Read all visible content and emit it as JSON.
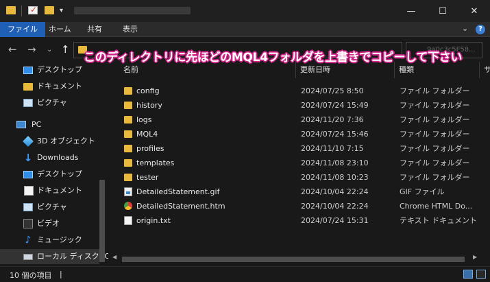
{
  "titlebar": {
    "dropdown_glyph": "▾",
    "minimize_glyph": "—",
    "maximize_glyph": "☐",
    "close_glyph": "✕"
  },
  "ribbon": {
    "tabs": [
      "ファイル",
      "ホーム",
      "共有",
      "表示"
    ],
    "expand_glyph": "⌄",
    "help_glyph": "?"
  },
  "address": {
    "back_glyph": "←",
    "forward_glyph": "→",
    "recent_glyph": "⌄",
    "up_glyph": "↑",
    "search_fragment": "9a0c3c5F58...",
    "annotation": "このディレクトリに先ほどのMQL4フォルダを上書きでコピーして下さい"
  },
  "nav": {
    "items": [
      {
        "label": "デスクトップ",
        "icon": "desktop-icon"
      },
      {
        "label": "ドキュメント",
        "icon": "folder-icon"
      },
      {
        "label": "ピクチャ",
        "icon": "pictures-icon"
      },
      {
        "label": "PC",
        "icon": "pc-icon"
      },
      {
        "label": "3D オブジェクト",
        "icon": "3d-objects-icon"
      },
      {
        "label": "Downloads",
        "icon": "download-icon"
      },
      {
        "label": "デスクトップ",
        "icon": "desktop-icon"
      },
      {
        "label": "ドキュメント",
        "icon": "document-icon"
      },
      {
        "label": "ピクチャ",
        "icon": "pictures-icon"
      },
      {
        "label": "ビデオ",
        "icon": "video-icon"
      },
      {
        "label": "ミュージック",
        "icon": "music-icon"
      },
      {
        "label": "ローカル ディスク (C",
        "icon": "drive-icon"
      }
    ]
  },
  "columns": {
    "name": "名前",
    "date": "更新日時",
    "type": "種類",
    "size": "サ"
  },
  "files": [
    {
      "name": "config",
      "date": "2024/07/25 8:50",
      "type": "ファイル フォルダー",
      "icon": "folder"
    },
    {
      "name": "history",
      "date": "2024/07/24 15:49",
      "type": "ファイル フォルダー",
      "icon": "folder"
    },
    {
      "name": "logs",
      "date": "2024/11/20 7:36",
      "type": "ファイル フォルダー",
      "icon": "folder"
    },
    {
      "name": "MQL4",
      "date": "2024/07/24 15:46",
      "type": "ファイル フォルダー",
      "icon": "folder"
    },
    {
      "name": "profiles",
      "date": "2024/11/10 7:15",
      "type": "ファイル フォルダー",
      "icon": "folder"
    },
    {
      "name": "templates",
      "date": "2024/11/08 23:10",
      "type": "ファイル フォルダー",
      "icon": "folder"
    },
    {
      "name": "tester",
      "date": "2024/11/08 10:23",
      "type": "ファイル フォルダー",
      "icon": "folder"
    },
    {
      "name": "DetailedStatement.gif",
      "date": "2024/10/04 22:24",
      "type": "GIF ファイル",
      "icon": "gif"
    },
    {
      "name": "DetailedStatement.htm",
      "date": "2024/10/04 22:24",
      "type": "Chrome HTML Do...",
      "icon": "htm"
    },
    {
      "name": "origin.txt",
      "date": "2024/07/24 15:31",
      "type": "テキスト ドキュメント",
      "icon": "txt"
    }
  ],
  "status": {
    "count_text": "10 個の項目",
    "separator": "|"
  },
  "colors": {
    "accent": "#1f5fb5",
    "folder": "#e8b93a",
    "annotation_outline": "#d0258a"
  }
}
